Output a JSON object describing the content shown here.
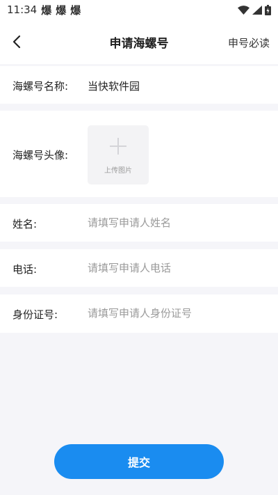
{
  "status_bar": {
    "time": "11:34",
    "notifications": [
      "爆",
      "爆",
      "爆"
    ]
  },
  "header": {
    "title": "申请海螺号",
    "action_label": "申号必读"
  },
  "form": {
    "name_row": {
      "label": "海螺号名称:",
      "value": "当快软件园"
    },
    "avatar_row": {
      "label": "海螺号头像:",
      "upload_label": "上传图片"
    },
    "applicant_name": {
      "label": "姓名:",
      "placeholder": "请填写申请人姓名"
    },
    "phone": {
      "label": "电话:",
      "placeholder": "请填写申请人电话"
    },
    "id_number": {
      "label": "身份证号:",
      "placeholder": "请填写申请人身份证号"
    }
  },
  "submit": {
    "label": "提交"
  },
  "colors": {
    "accent": "#1a8cf0",
    "background": "#f5f5f9",
    "placeholder": "#9a9a9a"
  },
  "icons": {
    "back": "chevron-left-icon",
    "wifi": "wifi-icon",
    "signal": "signal-icon",
    "battery": "battery-icon",
    "upload": "plus-icon"
  }
}
